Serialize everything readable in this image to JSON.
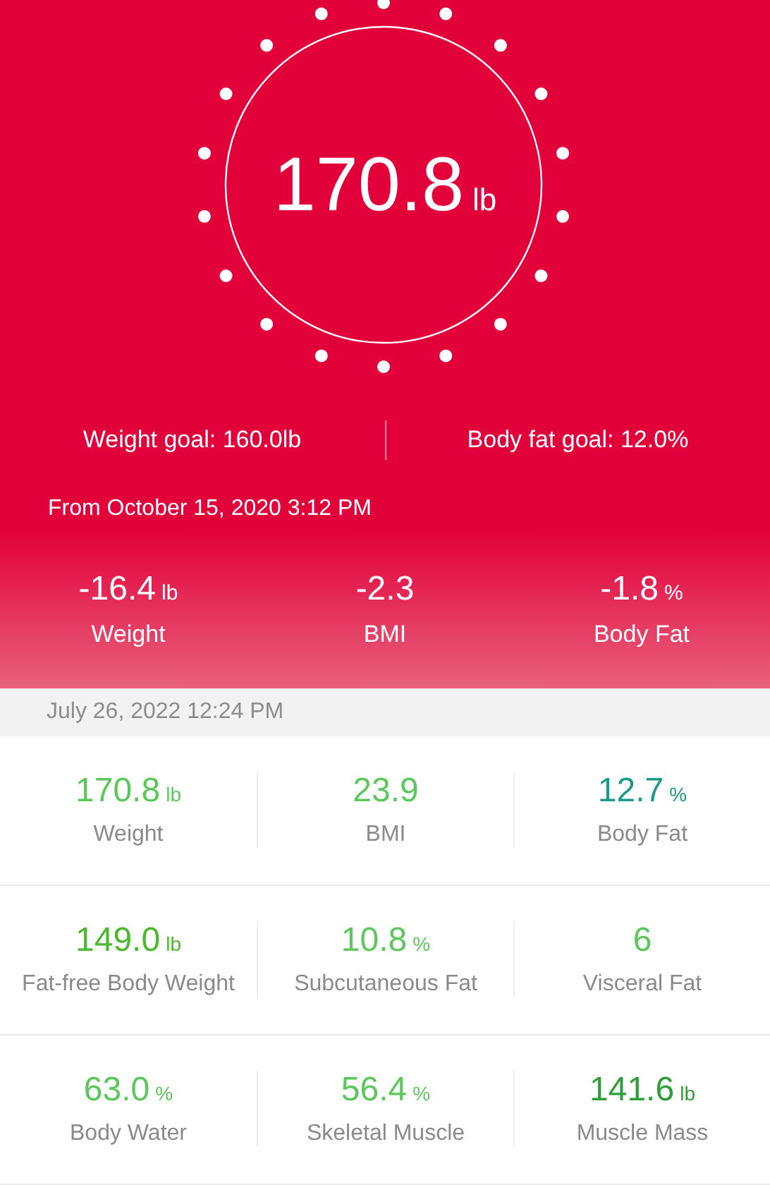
{
  "weight_display": {
    "value": "170.8",
    "unit": "lb"
  },
  "goals": [
    "Weight goal: 160.0lb",
    "Body fat goal: 12.0%"
  ],
  "change_since": {
    "label": "From October 15, 2020 3:12 PM",
    "items": [
      {
        "value": "-16.4",
        "unit": "lb",
        "label": "Weight"
      },
      {
        "value": "-2.3",
        "label": "BMI"
      },
      {
        "value": "-1.8",
        "unit": "%",
        "label": "Body Fat"
      }
    ]
  },
  "measurement_date": "July 26, 2022 12:24 PM",
  "metrics": [
    [
      {
        "value": "170.8",
        "unit": "lb",
        "label": "Weight",
        "color": "#5cc85c"
      },
      {
        "value": "23.9",
        "label": "BMI",
        "color": "#5cc85c"
      },
      {
        "value": "12.7",
        "unit": "%",
        "label": "Body Fat",
        "color": "#1b9a8c"
      }
    ],
    [
      {
        "value": "149.0",
        "unit": "lb",
        "label": "Fat-free Body Weight",
        "color": "#4cb82e"
      },
      {
        "value": "10.8",
        "unit": "%",
        "label": "Subcutaneous Fat",
        "color": "#5cc85c"
      },
      {
        "value": "6",
        "label": "Visceral Fat",
        "color": "#5cc85c"
      }
    ],
    [
      {
        "value": "63.0",
        "unit": "%",
        "label": "Body Water",
        "color": "#5cc85c"
      },
      {
        "value": "56.4",
        "unit": "%",
        "label": "Skeletal Muscle",
        "color": "#5cc85c"
      },
      {
        "value": "141.6",
        "unit": "lb",
        "label": "Muscle Mass",
        "color": "#2f9e3a"
      }
    ]
  ]
}
